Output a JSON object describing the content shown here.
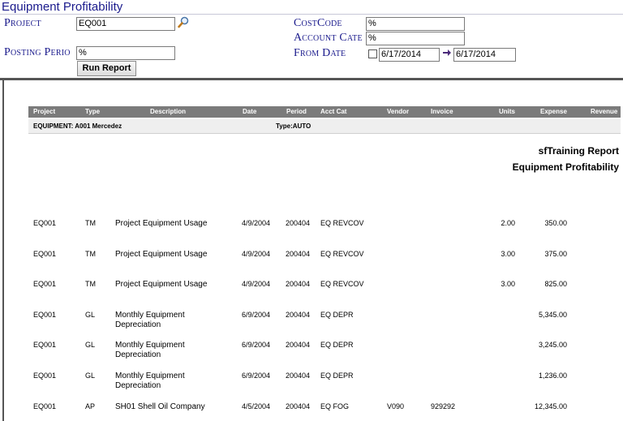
{
  "title": "Equipment Profitability",
  "form": {
    "project_label": "Project",
    "project_value": "EQ001",
    "posting_period_label": "Posting Perio",
    "posting_period_value": "%",
    "cost_code_label": "CostCode",
    "cost_code_value": "%",
    "account_cat_label": "Account Cate",
    "account_cat_value": "%",
    "from_date_label": "From Date",
    "from_date_value": "6/17/2014",
    "to_date_value": "6/17/2014",
    "run_report_label": "Run Report"
  },
  "report": {
    "company": "sfTraining Report",
    "name": "Equipment Profitability",
    "columns": [
      "Project",
      "Type",
      "Description",
      "Date",
      "Period",
      "Acct Cat",
      "Vendor",
      "Invoice",
      "Units",
      "Expense",
      "Revenue"
    ],
    "group_equipment": "EQUIPMENT: A001  Mercedez",
    "group_type": "Type:AUTO",
    "rows": [
      {
        "project": "EQ001",
        "type": "TM",
        "desc1": "Project Equipment Usage",
        "desc2": "",
        "date": "4/9/2004",
        "period": "200404",
        "acct_cat": "EQ REVCOV",
        "vendor": "",
        "invoice": "",
        "units": "2.00",
        "expense": "350.00",
        "revenue": ""
      },
      {
        "project": "EQ001",
        "type": "TM",
        "desc1": "Project Equipment Usage",
        "desc2": "",
        "date": "4/9/2004",
        "period": "200404",
        "acct_cat": "EQ REVCOV",
        "vendor": "",
        "invoice": "",
        "units": "3.00",
        "expense": "375.00",
        "revenue": ""
      },
      {
        "project": "EQ001",
        "type": "TM",
        "desc1": "Project Equipment Usage",
        "desc2": "",
        "date": "4/9/2004",
        "period": "200404",
        "acct_cat": "EQ REVCOV",
        "vendor": "",
        "invoice": "",
        "units": "3.00",
        "expense": "825.00",
        "revenue": ""
      },
      {
        "project": "EQ001",
        "type": "GL",
        "desc1": "Monthly Equipment",
        "desc2": "Depreciation",
        "date": "6/9/2004",
        "period": "200404",
        "acct_cat": "EQ DEPR",
        "vendor": "",
        "invoice": "",
        "units": "",
        "expense": "5,345.00",
        "revenue": ""
      },
      {
        "project": "EQ001",
        "type": "GL",
        "desc1": "Monthly Equipment",
        "desc2": "Depreciation",
        "date": "6/9/2004",
        "period": "200404",
        "acct_cat": "EQ DEPR",
        "vendor": "",
        "invoice": "",
        "units": "",
        "expense": "3,245.00",
        "revenue": ""
      },
      {
        "project": "EQ001",
        "type": "GL",
        "desc1": "Monthly Equipment",
        "desc2": "Depreciation",
        "date": "6/9/2004",
        "period": "200404",
        "acct_cat": "EQ DEPR",
        "vendor": "",
        "invoice": "",
        "units": "",
        "expense": "1,236.00",
        "revenue": ""
      },
      {
        "project": "EQ001",
        "type": "AP",
        "desc1": "SH01 Shell Oil Company",
        "desc2": "",
        "date": "4/5/2004",
        "period": "200404",
        "acct_cat": "EQ FOG",
        "vendor": "V090",
        "invoice": "929292",
        "units": "",
        "expense": "12,345.00",
        "revenue": ""
      }
    ]
  }
}
